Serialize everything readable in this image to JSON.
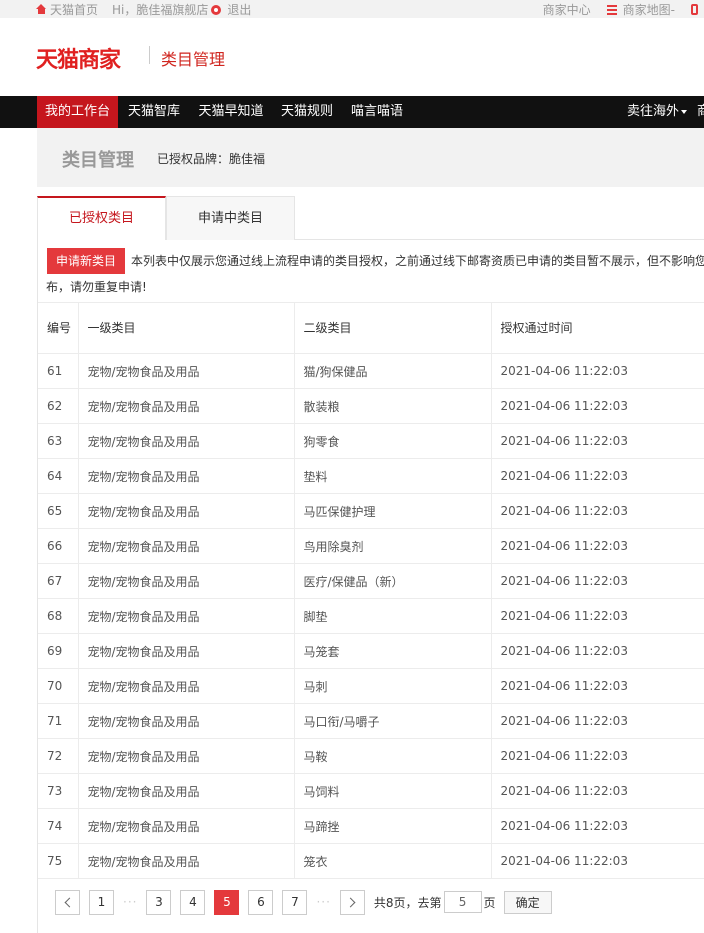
{
  "topbar": {
    "home_label": "天猫首页",
    "greeting": "Hi，脆佳福旗舰店",
    "logout_label": "退出",
    "merchant_center": "商家中心",
    "merchant_map": "商家地图",
    "map_dash": "-"
  },
  "header": {
    "logo": "天猫商家",
    "subtitle": "类目管理"
  },
  "nav": {
    "items": [
      "我的工作台",
      "天猫智库",
      "天猫早知道",
      "天猫规则",
      "喵言喵语"
    ],
    "overseas": "卖往海外",
    "cut_item": "商"
  },
  "page": {
    "title": "类目管理",
    "brand_label": "已授权品牌：脆佳福"
  },
  "tabs": [
    "已授权类目",
    "申请中类目"
  ],
  "notice": {
    "apply_button": "申请新类目",
    "text_line1": "本列表中仅展示您通过线上流程申请的类目授权，之前通过线下邮寄资质已申请的类目暂不展示，但不影响您",
    "text_line2": "布，请勿重复申请!"
  },
  "table": {
    "headers": [
      "编号",
      "一级类目",
      "二级类目",
      "授权通过时间"
    ],
    "rows": [
      [
        "61",
        "宠物/宠物食品及用品",
        "猫/狗保健品",
        "2021-04-06 11:22:03"
      ],
      [
        "62",
        "宠物/宠物食品及用品",
        "散装粮",
        "2021-04-06 11:22:03"
      ],
      [
        "63",
        "宠物/宠物食品及用品",
        "狗零食",
        "2021-04-06 11:22:03"
      ],
      [
        "64",
        "宠物/宠物食品及用品",
        "垫料",
        "2021-04-06 11:22:03"
      ],
      [
        "65",
        "宠物/宠物食品及用品",
        "马匹保健护理",
        "2021-04-06 11:22:03"
      ],
      [
        "66",
        "宠物/宠物食品及用品",
        "鸟用除臭剂",
        "2021-04-06 11:22:03"
      ],
      [
        "67",
        "宠物/宠物食品及用品",
        "医疗/保健品（新）",
        "2021-04-06 11:22:03"
      ],
      [
        "68",
        "宠物/宠物食品及用品",
        "脚垫",
        "2021-04-06 11:22:03"
      ],
      [
        "69",
        "宠物/宠物食品及用品",
        "马笼套",
        "2021-04-06 11:22:03"
      ],
      [
        "70",
        "宠物/宠物食品及用品",
        "马刺",
        "2021-04-06 11:22:03"
      ],
      [
        "71",
        "宠物/宠物食品及用品",
        "马口衔/马嚼子",
        "2021-04-06 11:22:03"
      ],
      [
        "72",
        "宠物/宠物食品及用品",
        "马鞍",
        "2021-04-06 11:22:03"
      ],
      [
        "73",
        "宠物/宠物食品及用品",
        "马饲料",
        "2021-04-06 11:22:03"
      ],
      [
        "74",
        "宠物/宠物食品及用品",
        "马蹄挫",
        "2021-04-06 11:22:03"
      ],
      [
        "75",
        "宠物/宠物食品及用品",
        "笼衣",
        "2021-04-06 11:22:03"
      ]
    ]
  },
  "pagination": {
    "pages": [
      "1",
      "3",
      "4",
      "5",
      "6",
      "7"
    ],
    "current": "5",
    "ellipsis": "···",
    "total_text": "共8页，去第",
    "page_suffix": "页",
    "input_value": "5",
    "confirm_label": "确定"
  },
  "colors": {
    "brand_red": "#c5161d",
    "button_red": "#e4393c",
    "nav_bg": "#111111"
  }
}
